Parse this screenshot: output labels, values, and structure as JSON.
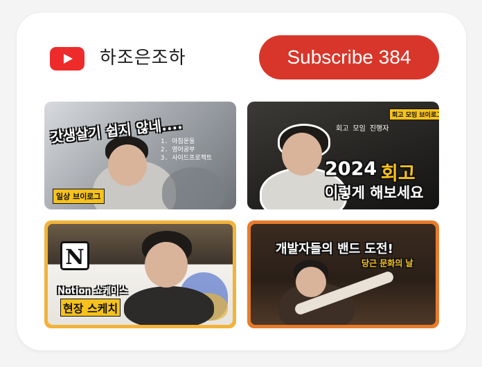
{
  "channel": {
    "name": "하조은조하",
    "subscribe_label": "Subscribe 384",
    "logo_icon": "youtube-play-icon",
    "brand_color": "#ee2b2b",
    "button_color": "#d8362a"
  },
  "videos": [
    {
      "title_text": "갓생살기 쉽지 않네....",
      "list_text": "1. 아침운동\n2. 영어공부\n3. 사이드프로젝트",
      "tag": "일상 브이로그"
    },
    {
      "tag": "회고 모임 브이로그",
      "handwritten": "회고 모임 진행자",
      "headline_year": "2024",
      "headline_word": "회고",
      "subline": "이렇게 해보세요"
    },
    {
      "logo_letter": "N",
      "line1": "Notion 쇼케이스",
      "line2": "현장 스케치"
    },
    {
      "headline": "개발자들의 밴드 도전!",
      "subline": "당근 문화의 날"
    }
  ]
}
